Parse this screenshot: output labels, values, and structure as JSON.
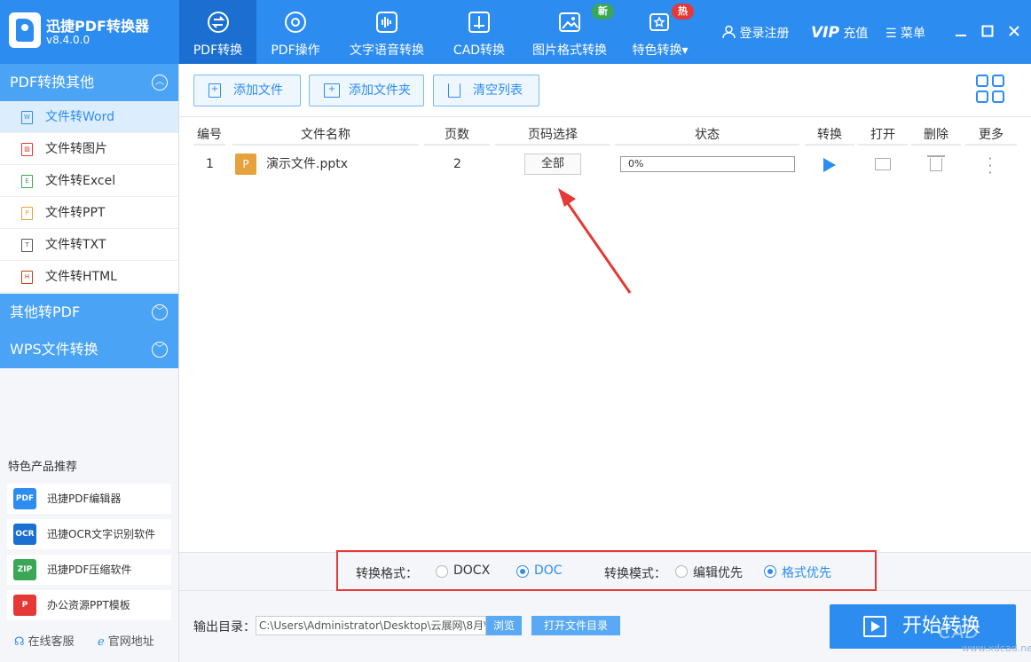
{
  "app": {
    "name": "迅捷PDF转换器",
    "version": "v8.4.0.0"
  },
  "nav": {
    "tabs": [
      {
        "label": "PDF转换",
        "icon": "convert-icon"
      },
      {
        "label": "PDF操作",
        "icon": "gear-icon"
      },
      {
        "label": "文字语音转换",
        "icon": "audio-wave-icon"
      },
      {
        "label": "CAD转换",
        "icon": "cad-icon"
      },
      {
        "label": "图片格式转换",
        "icon": "image-icon"
      },
      {
        "label": "特色转换",
        "icon": "star-icon"
      }
    ],
    "badge_new": "新",
    "badge_hot": "热",
    "login": "登录注册",
    "vip_brand": "VIP",
    "vip_label": "充值",
    "menu": "菜单"
  },
  "sidebar": {
    "section1": "PDF转换其他",
    "items": [
      {
        "label": "文件转Word",
        "glyph": "W",
        "color": "#2d8cf0"
      },
      {
        "label": "文件转图片",
        "glyph": "▨",
        "color": "#e53935"
      },
      {
        "label": "文件转Excel",
        "glyph": "E",
        "color": "#3aa757"
      },
      {
        "label": "文件转PPT",
        "glyph": "P",
        "color": "#e6a23c"
      },
      {
        "label": "文件转TXT",
        "glyph": "T",
        "color": "#555555"
      },
      {
        "label": "文件转HTML",
        "glyph": "H",
        "color": "#c2410c"
      }
    ],
    "section2": "其他转PDF",
    "section3": "WPS文件转换",
    "rec_title": "特色产品推荐",
    "recs": [
      {
        "label": "迅捷PDF编辑器",
        "glyph": "PDF"
      },
      {
        "label": "迅捷OCR文字识别软件",
        "glyph": "OCR"
      },
      {
        "label": "迅捷PDF压缩软件",
        "glyph": "ZIP"
      },
      {
        "label": "办公资源PPT模板",
        "glyph": "P"
      }
    ],
    "service": "在线客服",
    "website": "官网地址"
  },
  "toolbar": {
    "add_file": "添加文件",
    "add_folder": "添加文件夹",
    "clear_list": "清空列表"
  },
  "table": {
    "headers": [
      "编号",
      "文件名称",
      "页数",
      "页码选择",
      "状态",
      "转换",
      "打开",
      "删除",
      "更多"
    ],
    "rows": [
      {
        "index": "1",
        "file_glyph": "P",
        "name": "演示文件.pptx",
        "pages": "2",
        "page_select": "全部",
        "progress": "0%"
      }
    ]
  },
  "options": {
    "format_label": "转换格式：",
    "format_docx": "DOCX",
    "format_doc": "DOC",
    "mode_label": "转换模式：",
    "mode_edit": "编辑优先",
    "mode_format": "格式优先"
  },
  "output": {
    "label": "输出目录：",
    "path": "C:\\Users\\Administrator\\Desktop\\云展网\\8月\\",
    "browse": "浏览",
    "open_dir": "打开文件目录",
    "start": "开始转换"
  },
  "watermark": {
    "text": "CAD",
    "site": "www.xdcad.net"
  },
  "colors": {
    "primary": "#2d8cf0",
    "active_tab": "#1b6fd0",
    "section": "#4aa3f5",
    "highlight_box": "#e53935",
    "badge_new": "#3aa757",
    "badge_hot": "#e53935"
  }
}
